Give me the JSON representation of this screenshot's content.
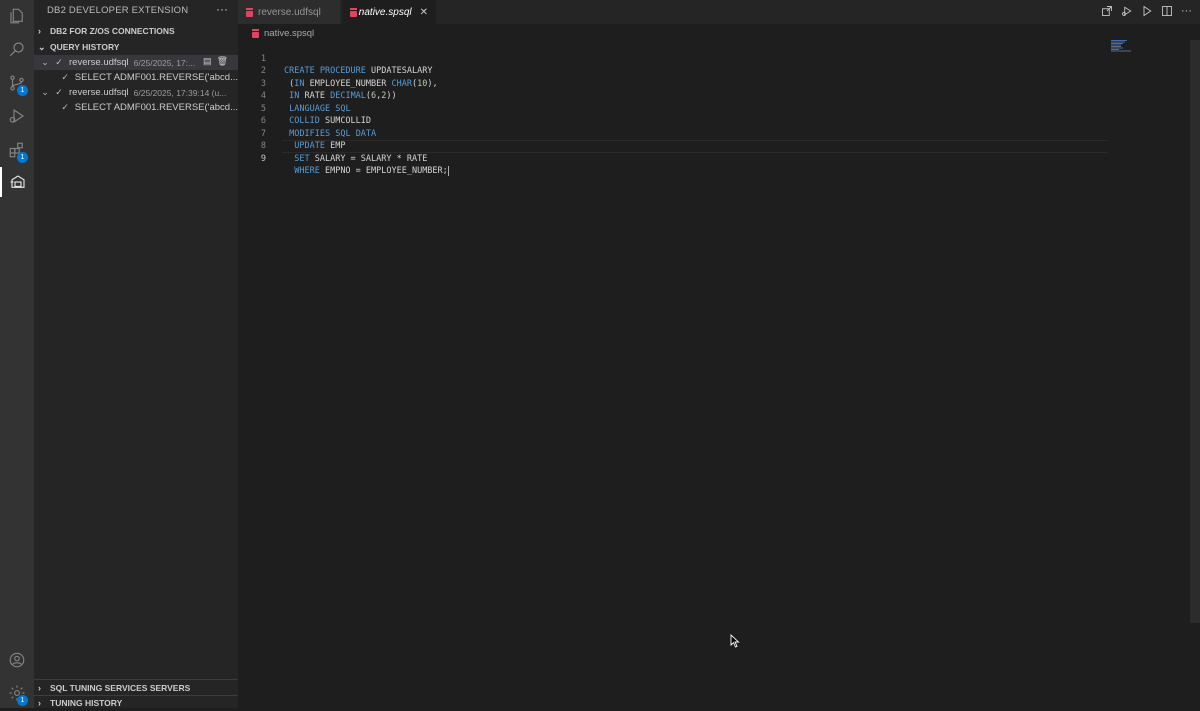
{
  "sidebar": {
    "title": "DB2 DEVELOPER EXTENSION",
    "more": "···",
    "connections_section": "DB2 FOR Z/OS CONNECTIONS",
    "history_section": "QUERY HISTORY",
    "history_items": [
      {
        "name": "reverse.udfsql",
        "meta": "6/25/2025, 17:...",
        "child": "SELECT ADMF001.REVERSE('abcd..."
      },
      {
        "name": "reverse.udfsql",
        "meta": "6/25/2025, 17:39:14 (u...",
        "child": "SELECT ADMF001.REVERSE('abcd..."
      }
    ],
    "tuning_servers_section": "SQL TUNING SERVICES SERVERS",
    "tuning_history_section": "TUNING HISTORY"
  },
  "activity": {
    "badges": {
      "source_control": "1",
      "extensions": "1",
      "settings": "1"
    }
  },
  "tabs": [
    {
      "label": "reverse.udfsql",
      "active": false
    },
    {
      "label": "native.spsql",
      "active": true
    }
  ],
  "breadcrumb": "native.spsql",
  "editor": {
    "line_numbers": [
      "1",
      "2",
      "3",
      "4",
      "5",
      "6",
      "7",
      "8",
      "9"
    ],
    "current_line": "9"
  },
  "colors": {
    "keyword": "#569cd6",
    "number": "#b5cea8",
    "accent": "#0078d4",
    "sql_file_icon": "#e0455f"
  }
}
